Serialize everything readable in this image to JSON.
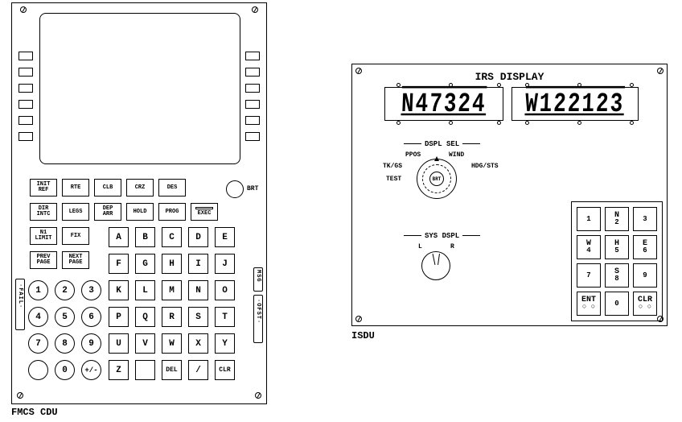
{
  "cdu": {
    "caption": "FMCS CDU",
    "brt_label": "BRT",
    "fn_row1": [
      "INIT\nREF",
      "RTE",
      "CLB",
      "CRZ",
      "DES"
    ],
    "fn_row2": [
      "DIR\nINTC",
      "LEGS",
      "DEP\nARR",
      "HOLD",
      "PROG"
    ],
    "exec_label": "EXEC",
    "fn_row3": [
      "N1\nLIMIT",
      "FIX"
    ],
    "fn_row4": [
      "PREV\nPAGE",
      "NEXT\nPAGE"
    ],
    "letters_r1": [
      "A",
      "B",
      "C",
      "D",
      "E"
    ],
    "letters_r2": [
      "F",
      "G",
      "H",
      "I",
      "J"
    ],
    "letters_r3": [
      "K",
      "L",
      "M",
      "N",
      "O"
    ],
    "letters_r4": [
      "P",
      "Q",
      "R",
      "S",
      "T"
    ],
    "letters_r5": [
      "U",
      "V",
      "W",
      "X",
      "Y"
    ],
    "letters_r6": [
      "Z",
      "",
      "DEL",
      "/",
      "CLR"
    ],
    "nums_r1": [
      "1",
      "2",
      "3"
    ],
    "nums_r2": [
      "4",
      "5",
      "6"
    ],
    "nums_r3": [
      "7",
      "8",
      "9"
    ],
    "nums_r4": [
      "",
      "0",
      "+/-"
    ],
    "ann_fail": "·FAIL·",
    "ann_msg": "MSG",
    "ann_ofst": "·OFST·"
  },
  "isdu": {
    "caption": "ISDU",
    "title": "IRS DISPLAY",
    "display_left": "N47324",
    "display_right": "W122123",
    "dspl_sel": {
      "heading": "DSPL SEL",
      "ppos": "PPOS",
      "wind": "WIND",
      "tkgs": "TK/GS",
      "hdgsts": "HDG/STS",
      "test": "TEST",
      "brt": "BRT"
    },
    "sys_dspl": {
      "heading": "SYS DSPL",
      "l": "L",
      "r": "R"
    },
    "keypad": [
      {
        "t": "",
        "n": "1"
      },
      {
        "t": "N",
        "n": "2"
      },
      {
        "t": "",
        "n": "3"
      },
      {
        "t": "W",
        "n": "4"
      },
      {
        "t": "H",
        "n": "5"
      },
      {
        "t": "E",
        "n": "6"
      },
      {
        "t": "",
        "n": "7"
      },
      {
        "t": "S",
        "n": "8"
      },
      {
        "t": "",
        "n": "9"
      },
      {
        "t": "ENT",
        "n": "○ ○"
      },
      {
        "t": "",
        "n": "0"
      },
      {
        "t": "CLR",
        "n": "○ ○"
      }
    ]
  }
}
